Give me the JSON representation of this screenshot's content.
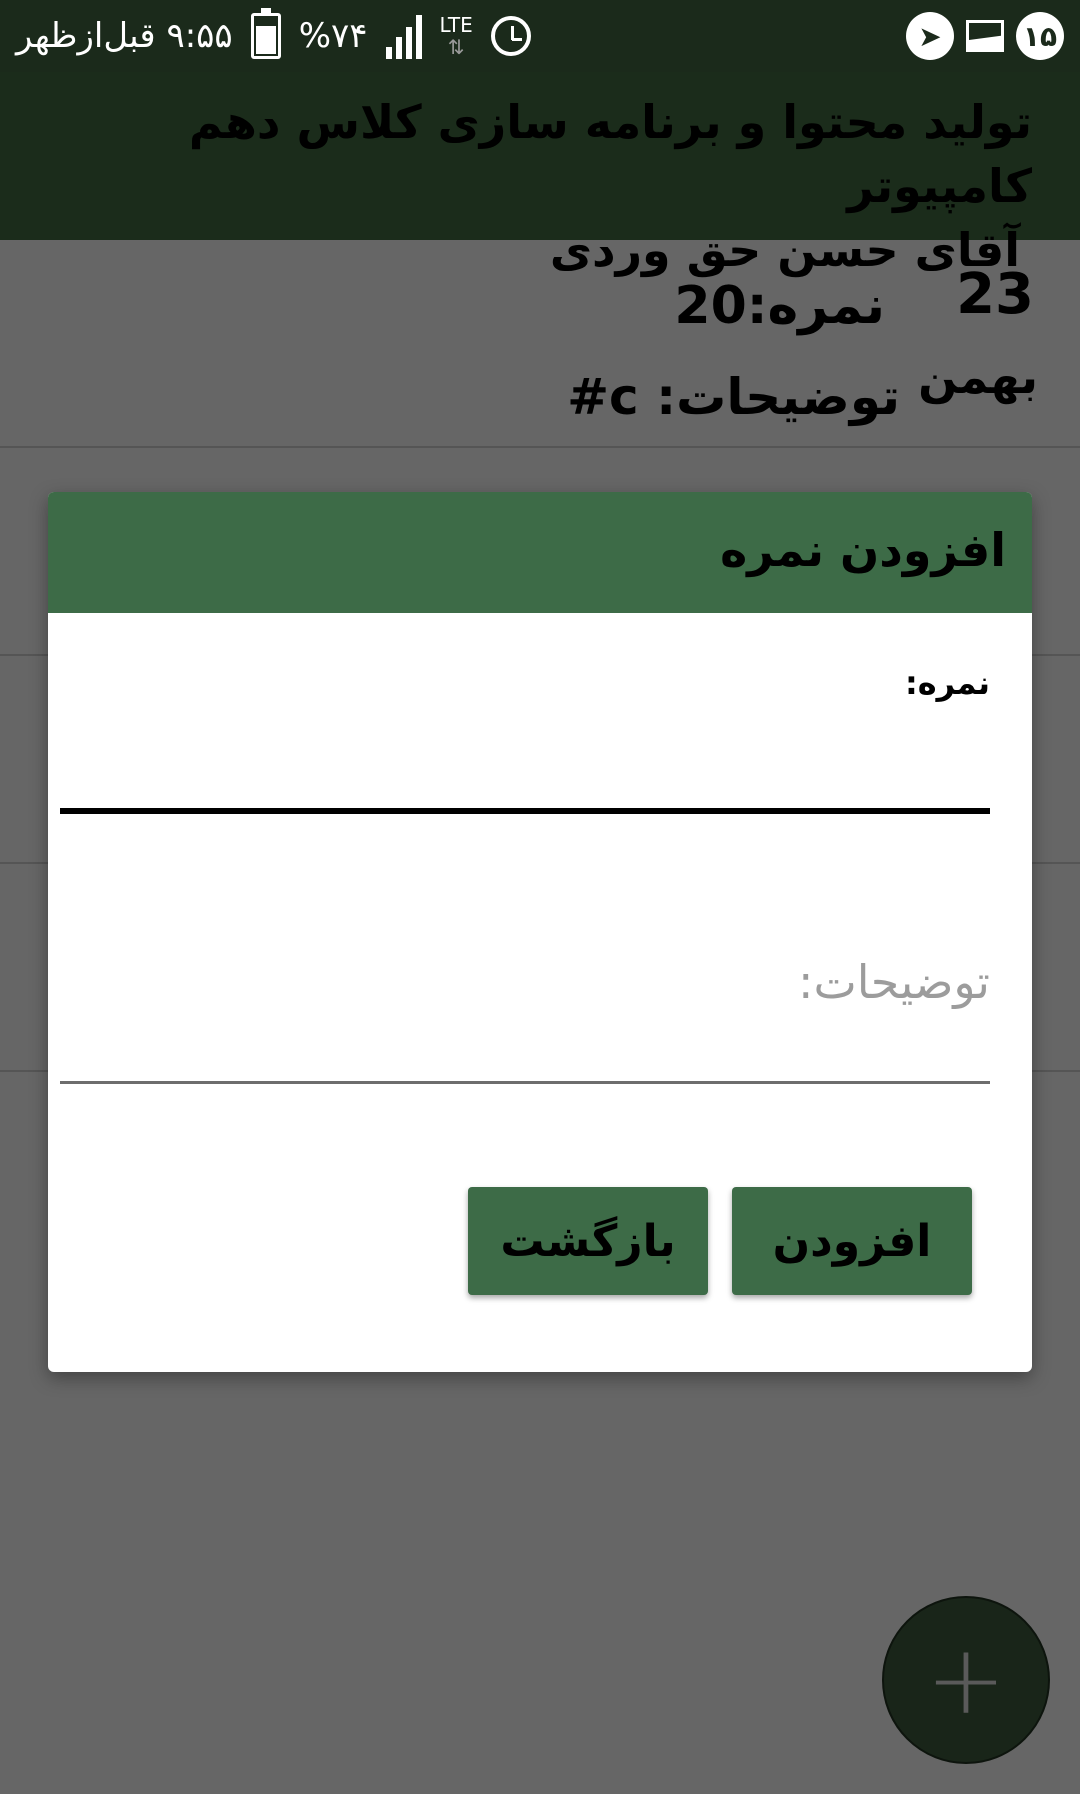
{
  "status_bar": {
    "time": "۹:۵۵ قبل‌ازظهر",
    "battery_percent": "%۷۴",
    "battery_level": 0.74,
    "network_label": "LTE",
    "notification_count": "۱۵",
    "icons": [
      "battery-icon",
      "signal-icon",
      "alarm-icon",
      "gallery-icon",
      "telegram-icon"
    ]
  },
  "app_bar": {
    "title_line1": "تولید محتوا و برنامه سازی کلاس دهم کامپیوتر",
    "title_line2": "آقای حسن حق وردی"
  },
  "list": {
    "items": [
      {
        "day": "23",
        "month": "بهمن",
        "grade": "نمره:20",
        "description": "توضیحات: c#"
      }
    ]
  },
  "dialog": {
    "title": "افزودن نمره",
    "grade_label": "نمره:",
    "grade_value": "",
    "description_placeholder": "توضیحات:",
    "add_button": "افزودن",
    "back_button": "بازگشت"
  },
  "fab": {
    "icon": "plus-icon",
    "symbol": "+"
  },
  "colors": {
    "primary": "#3d6b47",
    "dark_primary": "#1b2c1b",
    "scrim_background": "#666666"
  }
}
